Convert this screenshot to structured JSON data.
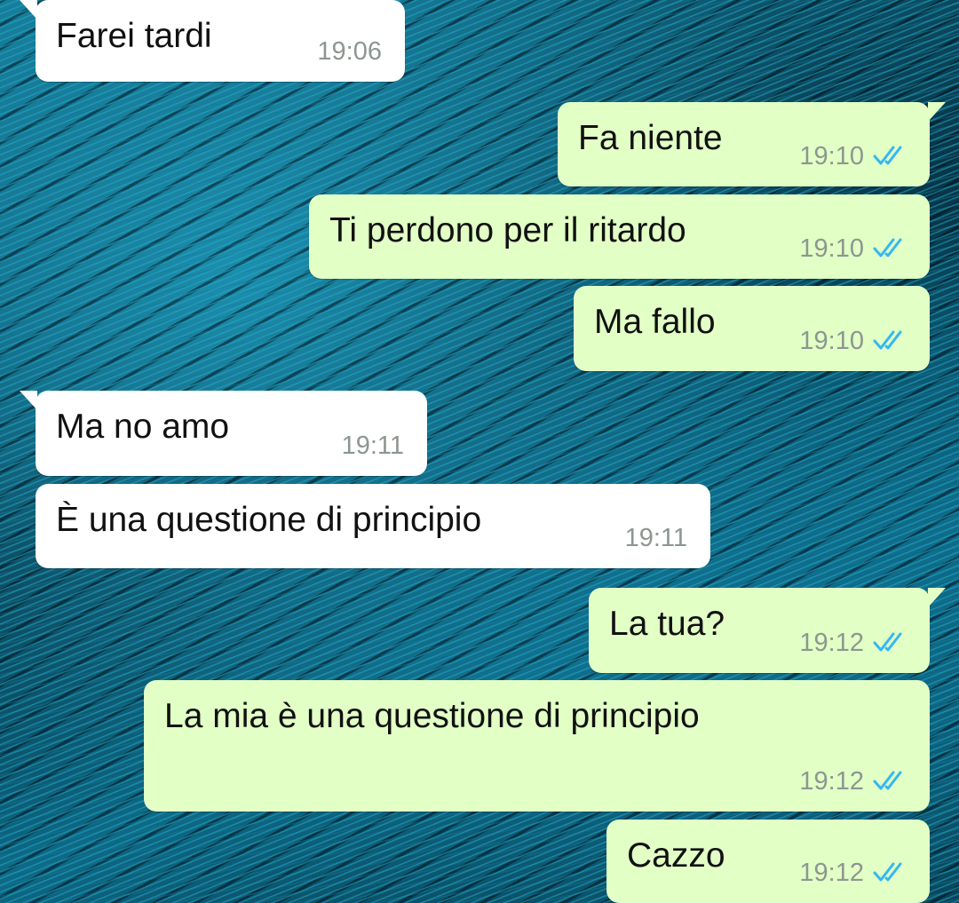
{
  "messages": [
    {
      "direction": "incoming",
      "text": "Farei tardi",
      "time": "19:06"
    },
    {
      "direction": "outgoing",
      "text": "Fa niente",
      "time": "19:10",
      "status_icon": "double-check-icon",
      "status_color": "#34b7f1"
    },
    {
      "direction": "outgoing",
      "text": "Ti perdono per il ritardo",
      "time": "19:10",
      "status_icon": "double-check-icon",
      "status_color": "#34b7f1"
    },
    {
      "direction": "outgoing",
      "text": "Ma fallo",
      "time": "19:10",
      "status_icon": "double-check-icon",
      "status_color": "#34b7f1"
    },
    {
      "direction": "incoming",
      "text": "Ma no amo",
      "time": "19:11"
    },
    {
      "direction": "incoming",
      "text": "È una questione di principio",
      "time": "19:11"
    },
    {
      "direction": "outgoing",
      "text": "La tua?",
      "time": "19:12",
      "status_icon": "double-check-icon",
      "status_color": "#34b7f1"
    },
    {
      "direction": "outgoing",
      "text": "La mia è una questione di principio",
      "time": "19:12",
      "status_icon": "double-check-icon",
      "status_color": "#34b7f1"
    },
    {
      "direction": "outgoing",
      "text": "Cazzo",
      "time": "19:12",
      "status_icon": "double-check-icon",
      "status_color": "#34b7f1"
    }
  ],
  "colors": {
    "incoming_bubble": "#ffffff",
    "outgoing_bubble": "#e2ffc6",
    "read_ticks": "#34b7f1",
    "timestamp": "#8d9690"
  }
}
